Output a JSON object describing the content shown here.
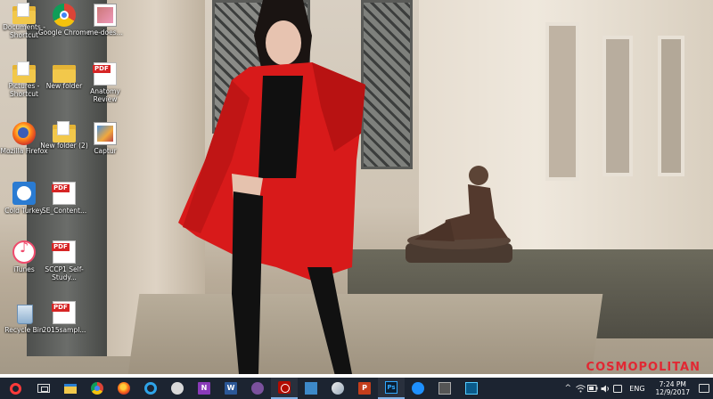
{
  "desktop": {
    "icons": [
      {
        "label": "Documents - Shortcut",
        "type": "folder-doc"
      },
      {
        "label": "Google Chrome",
        "type": "chrome"
      },
      {
        "label": "me-does...",
        "type": "image"
      },
      {
        "label": "Pictures - Shortcut",
        "type": "folder"
      },
      {
        "label": "New folder",
        "type": "folder"
      },
      {
        "label": "Anatomy Review",
        "type": "pdf"
      },
      {
        "label": "Mozilla Firefox",
        "type": "firefox"
      },
      {
        "label": "New folder (2)",
        "type": "folder-doc"
      },
      {
        "label": "Captur",
        "type": "photo"
      },
      {
        "label": "Cold Turkey",
        "type": "cold-turkey"
      },
      {
        "label": "SE_Content...",
        "type": "pdf"
      },
      {
        "label": "iTunes",
        "type": "itunes"
      },
      {
        "label": "SCCP1 Self-Study...",
        "type": "pdf"
      },
      {
        "label": "Recycle Bin",
        "type": "recycle-bin"
      },
      {
        "label": "2015sampl...",
        "type": "pdf"
      }
    ]
  },
  "wallpaper": {
    "watermark": "COSMOPOLITAN"
  },
  "taskbar": {
    "pinned": [
      {
        "name": "start-button",
        "glyph": "start",
        "active": false
      },
      {
        "name": "task-view-button",
        "glyph": "taskview",
        "active": false
      },
      {
        "name": "file-explorer-taskbar-button",
        "glyph": "explorer",
        "active": false
      },
      {
        "name": "chrome-taskbar-button",
        "glyph": "chrome",
        "active": false
      },
      {
        "name": "firefox-taskbar-button",
        "glyph": "firefox",
        "active": false
      },
      {
        "name": "internet-explorer-taskbar-button",
        "glyph": "ie",
        "active": false
      },
      {
        "name": "skype-taskbar-button",
        "glyph": "skype",
        "active": false
      },
      {
        "name": "onenote-taskbar-button",
        "glyph": "onenote",
        "active": false
      },
      {
        "name": "word-taskbar-button",
        "glyph": "word",
        "active": false
      },
      {
        "name": "viber-taskbar-button",
        "glyph": "viber",
        "active": false
      },
      {
        "name": "acrobat-taskbar-button",
        "glyph": "acrobat",
        "active": true
      },
      {
        "name": "app-taskbar-button",
        "glyph": "app1",
        "active": false
      },
      {
        "name": "app2-taskbar-button",
        "glyph": "app2",
        "active": false
      },
      {
        "name": "powerpoint-taskbar-button",
        "glyph": "ppt",
        "active": false
      },
      {
        "name": "photoshop-taskbar-button",
        "glyph": "ps",
        "active": true
      },
      {
        "name": "app3-taskbar-button",
        "glyph": "app3",
        "active": false
      },
      {
        "name": "calculator-taskbar-button",
        "glyph": "calc",
        "active": false
      },
      {
        "name": "app4-taskbar-button",
        "glyph": "app4",
        "active": false
      }
    ],
    "tray": {
      "chevron": "^",
      "language": "ENG",
      "time": "7:24 PM",
      "date": "12/9/2017"
    }
  },
  "colors": {
    "taskbar_bg": "#1c2431",
    "start_accent": "#ff3a3a",
    "active_underline": "#7fb0e6"
  }
}
